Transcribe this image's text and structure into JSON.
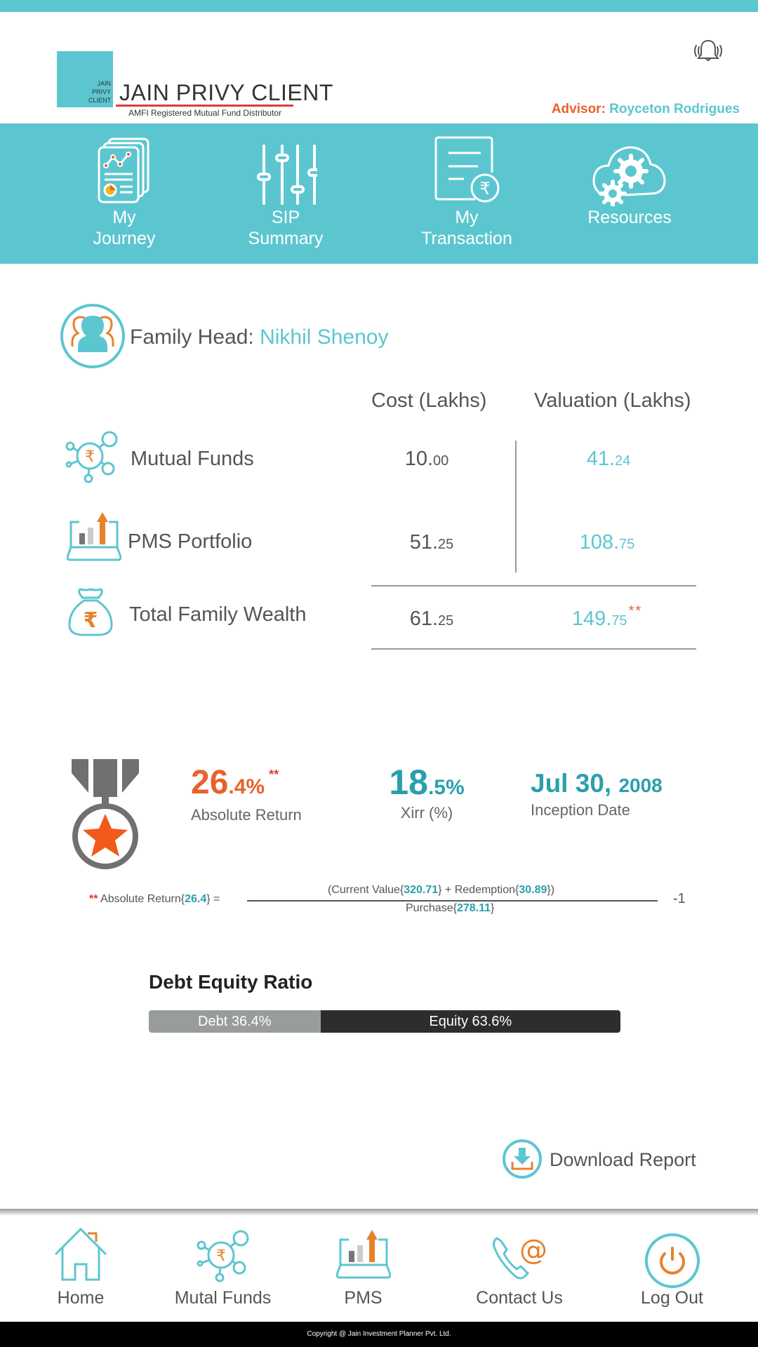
{
  "header": {
    "logo_mini_lines": [
      "JAIN",
      "PRIVY",
      "CLIENT"
    ],
    "logo_title": "JAIN PRIVY CLIENT",
    "logo_subtitle": "AMFI Registered Mutual Fund Distributor",
    "advisor_label": "Advisor:",
    "advisor_name": "Royceton Rodrigues",
    "notification_icon": "bell-ringing-icon"
  },
  "top_nav": [
    {
      "line1": "My",
      "line2": "Journey",
      "icon": "report-chart-icon"
    },
    {
      "line1": "SIP",
      "line2": "Summary",
      "icon": "sliders-icon"
    },
    {
      "line1": "My",
      "line2": "Transaction",
      "icon": "document-rupee-icon"
    },
    {
      "line1": "Resources",
      "line2": "",
      "icon": "cloud-gears-icon"
    }
  ],
  "family": {
    "label": "Family Head:",
    "name": "Nikhil Shenoy"
  },
  "holdings": {
    "columns": [
      "Cost (Lakhs)",
      "Valuation (Lakhs)"
    ],
    "rows": [
      {
        "label": "Mutual Funds",
        "cost_int": "10.",
        "cost_dec": "00",
        "val_int": "41.",
        "val_dec": "24",
        "icon": "mutual-funds-icon"
      },
      {
        "label": "PMS Portfolio",
        "cost_int": "51.",
        "cost_dec": "25",
        "val_int": "108.",
        "val_dec": "75",
        "icon": "pms-laptop-chart-icon"
      },
      {
        "label": "Total Family Wealth",
        "cost_int": "61.",
        "cost_dec": "25",
        "val_int": "149.",
        "val_dec": "75",
        "val_note": "**",
        "icon": "money-bag-icon"
      }
    ]
  },
  "stats": {
    "absolute_return": {
      "int": "26",
      "dec": ".4%",
      "note": "**",
      "label": "Absolute Return"
    },
    "xirr": {
      "int": "18",
      "dec": ".5%",
      "label": "Xirr (%)"
    },
    "inception": {
      "date": "Jul 30,",
      "year": "2008",
      "label": "Inception Date"
    }
  },
  "formula": {
    "marker": "**",
    "lhs_text": "Absolute Return{",
    "lhs_value": "26.4",
    "lhs_end": "} =",
    "num_a": "(Current Value{",
    "current_value": "320.71",
    "num_b": "} + Redemption{",
    "redemption": "30.89",
    "num_c": "})",
    "den_a": "Purchase{",
    "purchase": "278.11",
    "den_b": "}",
    "tail": "-1"
  },
  "debt_equity": {
    "title": "Debt Equity Ratio",
    "debt_label": "Debt 36.4%",
    "equity_label": "Equity 63.6%",
    "debt_pct": 36.4,
    "equity_pct": 63.6
  },
  "download": {
    "label": "Download Report"
  },
  "bottom_nav": [
    {
      "label": "Home",
      "icon": "home-icon"
    },
    {
      "label": "Mutal Funds",
      "icon": "mutual-funds-icon"
    },
    {
      "label": "PMS",
      "icon": "pms-laptop-chart-icon"
    },
    {
      "label": "Contact Us",
      "icon": "phone-at-icon"
    },
    {
      "label": "Log Out",
      "icon": "power-icon"
    }
  ],
  "footer": {
    "copyright": "Copyright @ Jain Investment Planner Pvt. Ltd."
  },
  "colors": {
    "brand_teal": "#5cc6d0",
    "accent_orange": "#e8612c",
    "deep_teal": "#2a9fad",
    "red": "#e23a3a"
  }
}
